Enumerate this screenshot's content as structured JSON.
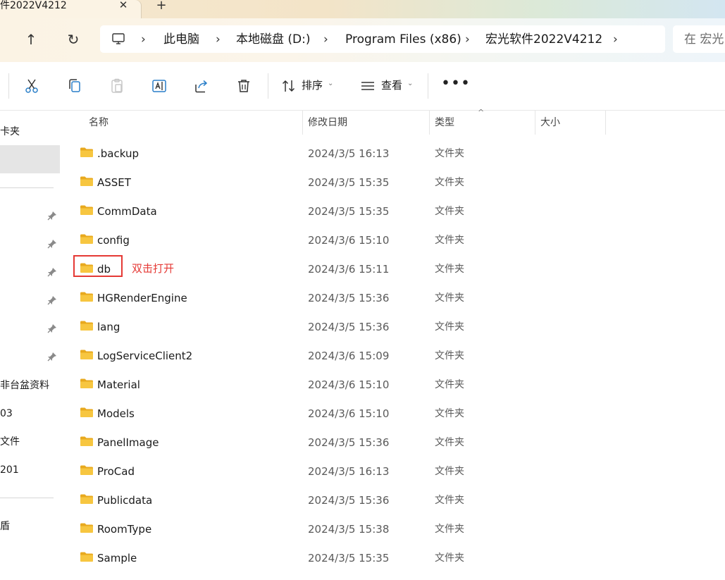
{
  "tab": {
    "title": "件2022V4212",
    "close_label": "✕",
    "new_label": "+"
  },
  "nav": {
    "up_label": "↑",
    "refresh_label": "↻"
  },
  "breadcrumb": [
    {
      "label": "此电脑"
    },
    {
      "label": "本地磁盘 (D:)"
    },
    {
      "label": "Program Files (x86)"
    },
    {
      "label": "宏光软件2022V4212"
    }
  ],
  "breadcrumb_sep": "›",
  "search": {
    "placeholder": "在 宏光"
  },
  "toolbar": {
    "sort_label": "排序",
    "view_label": "查看",
    "more_label": "•••",
    "chevron": "⌄"
  },
  "sidebar": {
    "items": [
      {
        "label": "卡夹"
      },
      {
        "label": "非台盆资料"
      },
      {
        "label": "03"
      },
      {
        "label": "文件"
      },
      {
        "label": "201"
      },
      {
        "label": "盾"
      }
    ]
  },
  "columns": {
    "name": "名称",
    "date": "修改日期",
    "type": "类型",
    "size": "大小",
    "sort_indicator": "^"
  },
  "files": [
    {
      "name": ".backup",
      "date": "2024/3/5 16:13",
      "type": "文件夹"
    },
    {
      "name": "ASSET",
      "date": "2024/3/5 15:35",
      "type": "文件夹"
    },
    {
      "name": "CommData",
      "date": "2024/3/5 15:35",
      "type": "文件夹"
    },
    {
      "name": "config",
      "date": "2024/3/6 15:10",
      "type": "文件夹"
    },
    {
      "name": "db",
      "date": "2024/3/6 15:11",
      "type": "文件夹"
    },
    {
      "name": "HGRenderEngine",
      "date": "2024/3/5 15:36",
      "type": "文件夹"
    },
    {
      "name": "lang",
      "date": "2024/3/5 15:36",
      "type": "文件夹"
    },
    {
      "name": "LogServiceClient2",
      "date": "2024/3/6 15:09",
      "type": "文件夹"
    },
    {
      "name": "Material",
      "date": "2024/3/6 15:10",
      "type": "文件夹"
    },
    {
      "name": "Models",
      "date": "2024/3/6 15:10",
      "type": "文件夹"
    },
    {
      "name": "PanelImage",
      "date": "2024/3/5 15:36",
      "type": "文件夹"
    },
    {
      "name": "ProCad",
      "date": "2024/3/5 16:13",
      "type": "文件夹"
    },
    {
      "name": "Publicdata",
      "date": "2024/3/5 15:36",
      "type": "文件夹"
    },
    {
      "name": "RoomType",
      "date": "2024/3/5 15:38",
      "type": "文件夹"
    },
    {
      "name": "Sample",
      "date": "2024/3/5 15:35",
      "type": "文件夹"
    }
  ],
  "annotation": {
    "text": "双击打开",
    "color": "#e53935"
  },
  "colors": {
    "folder": "#f7c640",
    "folder_dark": "#e8a91e",
    "accent": "#1a73e8"
  }
}
